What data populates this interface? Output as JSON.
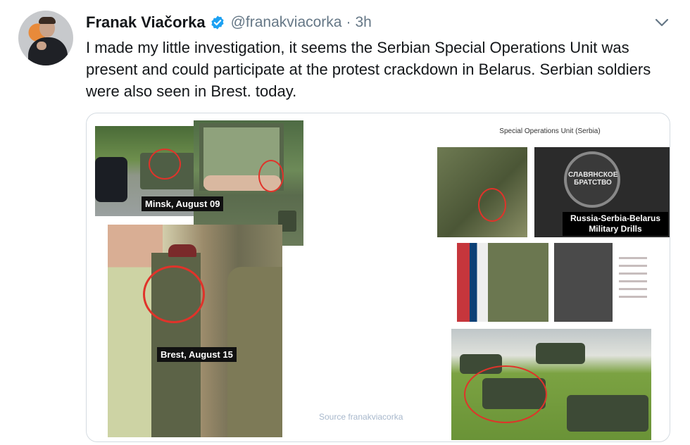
{
  "tweet": {
    "author": {
      "display_name": "Franak Viačorka",
      "handle": "@franakviacorka",
      "verified": true
    },
    "separator": "·",
    "timestamp": "3h",
    "text": "I made my little investigation, it seems the Serbian Special Operations Unit was present and could participate at the protest crackdown in Belarus. Serbian soldiers were also seen in Brest. today.",
    "menu_icon": "chevron-down-icon"
  },
  "media": {
    "minsk_caption": "Minsk, August 09",
    "brest_caption": "Brest, August 15",
    "slide_title": "Special Operations Unit (Serbia)",
    "emblem_text": "СЛАВЯНСКОЕ БРАТСТВО",
    "drills_caption": "Russia-Serbia-Belarus Military Drills",
    "source": "Source franakviacorka"
  },
  "colors": {
    "text": "#14171a",
    "secondary": "#657786",
    "verified": "#1da1f2",
    "highlight_circle": "#e0332a",
    "card_border": "#d4dbe1"
  }
}
